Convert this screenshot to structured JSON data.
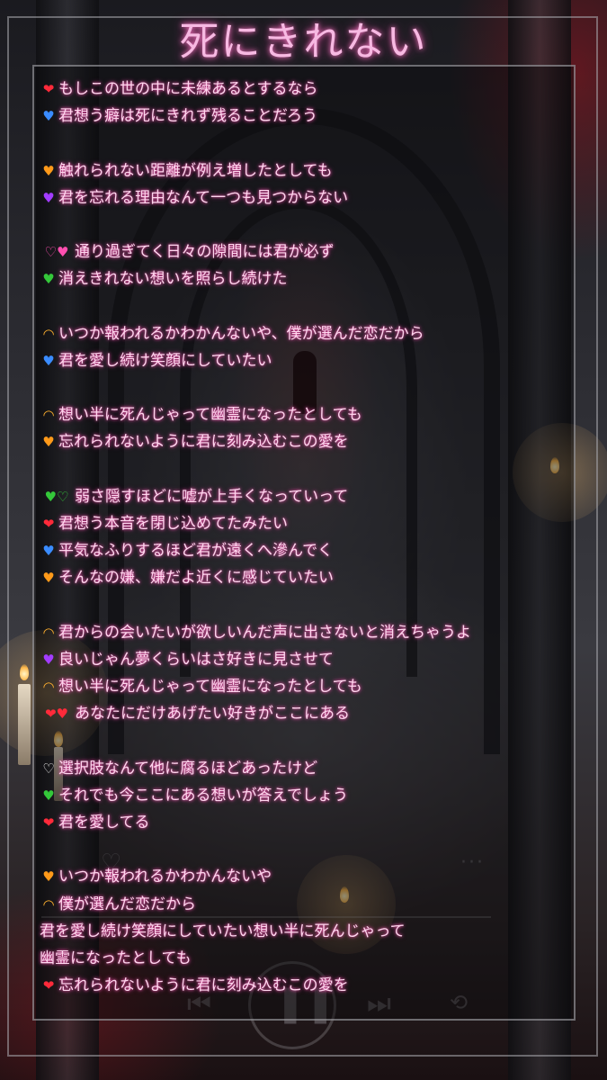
{
  "title": "死にきれない",
  "colors": {
    "title": "#f7b9e2",
    "lyric_text": "#ffd6ee",
    "lyric_glow": "#ff5cb8",
    "frame": "#c8c8cd"
  },
  "lyrics": [
    {
      "emoji": "❤",
      "color": "#ff2a3a",
      "text": "もしこの世の中に未練あるとするなら"
    },
    {
      "emoji": "♥",
      "color": "#3a8cff",
      "text": "君想う癖は死にきれず残ることだろう"
    },
    {
      "emoji": "",
      "color": "",
      "text": ""
    },
    {
      "emoji": "♥",
      "color": "#ff9a1a",
      "text": "触れられない距離が例え増したとしても"
    },
    {
      "emoji": "♥",
      "color": "#a23cff",
      "text": "君を忘れる理由なんて一つも見つからない"
    },
    {
      "emoji": "",
      "color": "",
      "text": ""
    },
    {
      "emoji": "♡♥",
      "color": "#ff4fb0",
      "text": "通り過ぎてく日々の隙間には君が必ず"
    },
    {
      "emoji": "♥",
      "color": "#34c83a",
      "text": "消えきれない想いを照らし続けた"
    },
    {
      "emoji": "",
      "color": "",
      "text": ""
    },
    {
      "emoji": "◠",
      "color": "#ffb02e",
      "text": "いつか報われるかわかんないや、僕が選んだ恋だから"
    },
    {
      "emoji": "♥",
      "color": "#3a8cff",
      "text": "君を愛し続け笑顔にしていたい"
    },
    {
      "emoji": "",
      "color": "",
      "text": ""
    },
    {
      "emoji": "◠",
      "color": "#ffb02e",
      "text": "想い半に死んじゃって幽霊になったとしても"
    },
    {
      "emoji": "♥",
      "color": "#ff9a1a",
      "text": "忘れられないように君に刻み込むこの愛を"
    },
    {
      "emoji": "",
      "color": "",
      "text": ""
    },
    {
      "emoji": "♥♡",
      "color": "#34c83a",
      "text": "弱さ隠すほどに嘘が上手くなっていって"
    },
    {
      "emoji": "❤",
      "color": "#ff2a3a",
      "text": "君想う本音を閉じ込めてたみたい"
    },
    {
      "emoji": "♥",
      "color": "#3a8cff",
      "text": "平気なふりするほど君が遠くへ滲んでく"
    },
    {
      "emoji": "♥",
      "color": "#ff9a1a",
      "text": "そんなの嫌、嫌だよ近くに感じていたい"
    },
    {
      "emoji": "",
      "color": "",
      "text": ""
    },
    {
      "emoji": "◠",
      "color": "#ffb02e",
      "text": "君からの会いたいが欲しいんだ声に出さないと消えちゃうよ"
    },
    {
      "emoji": "♥",
      "color": "#a23cff",
      "text": "良いじゃん夢くらいはさ好きに見させて"
    },
    {
      "emoji": "◠",
      "color": "#ffb02e",
      "text": "想い半に死んじゃって幽霊になったとしても"
    },
    {
      "emoji": "❤♥",
      "color": "#ff2a3a",
      "text": "あなたにだけあげたい好きがここにある"
    },
    {
      "emoji": "",
      "color": "",
      "text": ""
    },
    {
      "emoji": "♡",
      "color": "#f0f0f0",
      "text": "選択肢なんて他に腐るほどあったけど"
    },
    {
      "emoji": "♥",
      "color": "#34c83a",
      "text": "それでも今ここにある想いが答えでしょう"
    },
    {
      "emoji": "❤",
      "color": "#ff2a3a",
      "text": "君を愛してる"
    },
    {
      "emoji": "",
      "color": "",
      "text": ""
    },
    {
      "emoji": "♥",
      "color": "#ff9a1a",
      "text": "いつか報われるかわかんないや"
    },
    {
      "emoji": "◠",
      "color": "#ffb02e",
      "text": "僕が選んだ恋だから"
    },
    {
      "emoji": "",
      "color": "",
      "text": "君を愛し続け笑顔にしていたい想い半に死んじゃって"
    },
    {
      "emoji": "",
      "color": "",
      "text": "幽霊になったとしても"
    },
    {
      "emoji": "❤",
      "color": "#ff2a3a",
      "text": "忘れられないように君に刻み込むこの愛を"
    }
  ]
}
